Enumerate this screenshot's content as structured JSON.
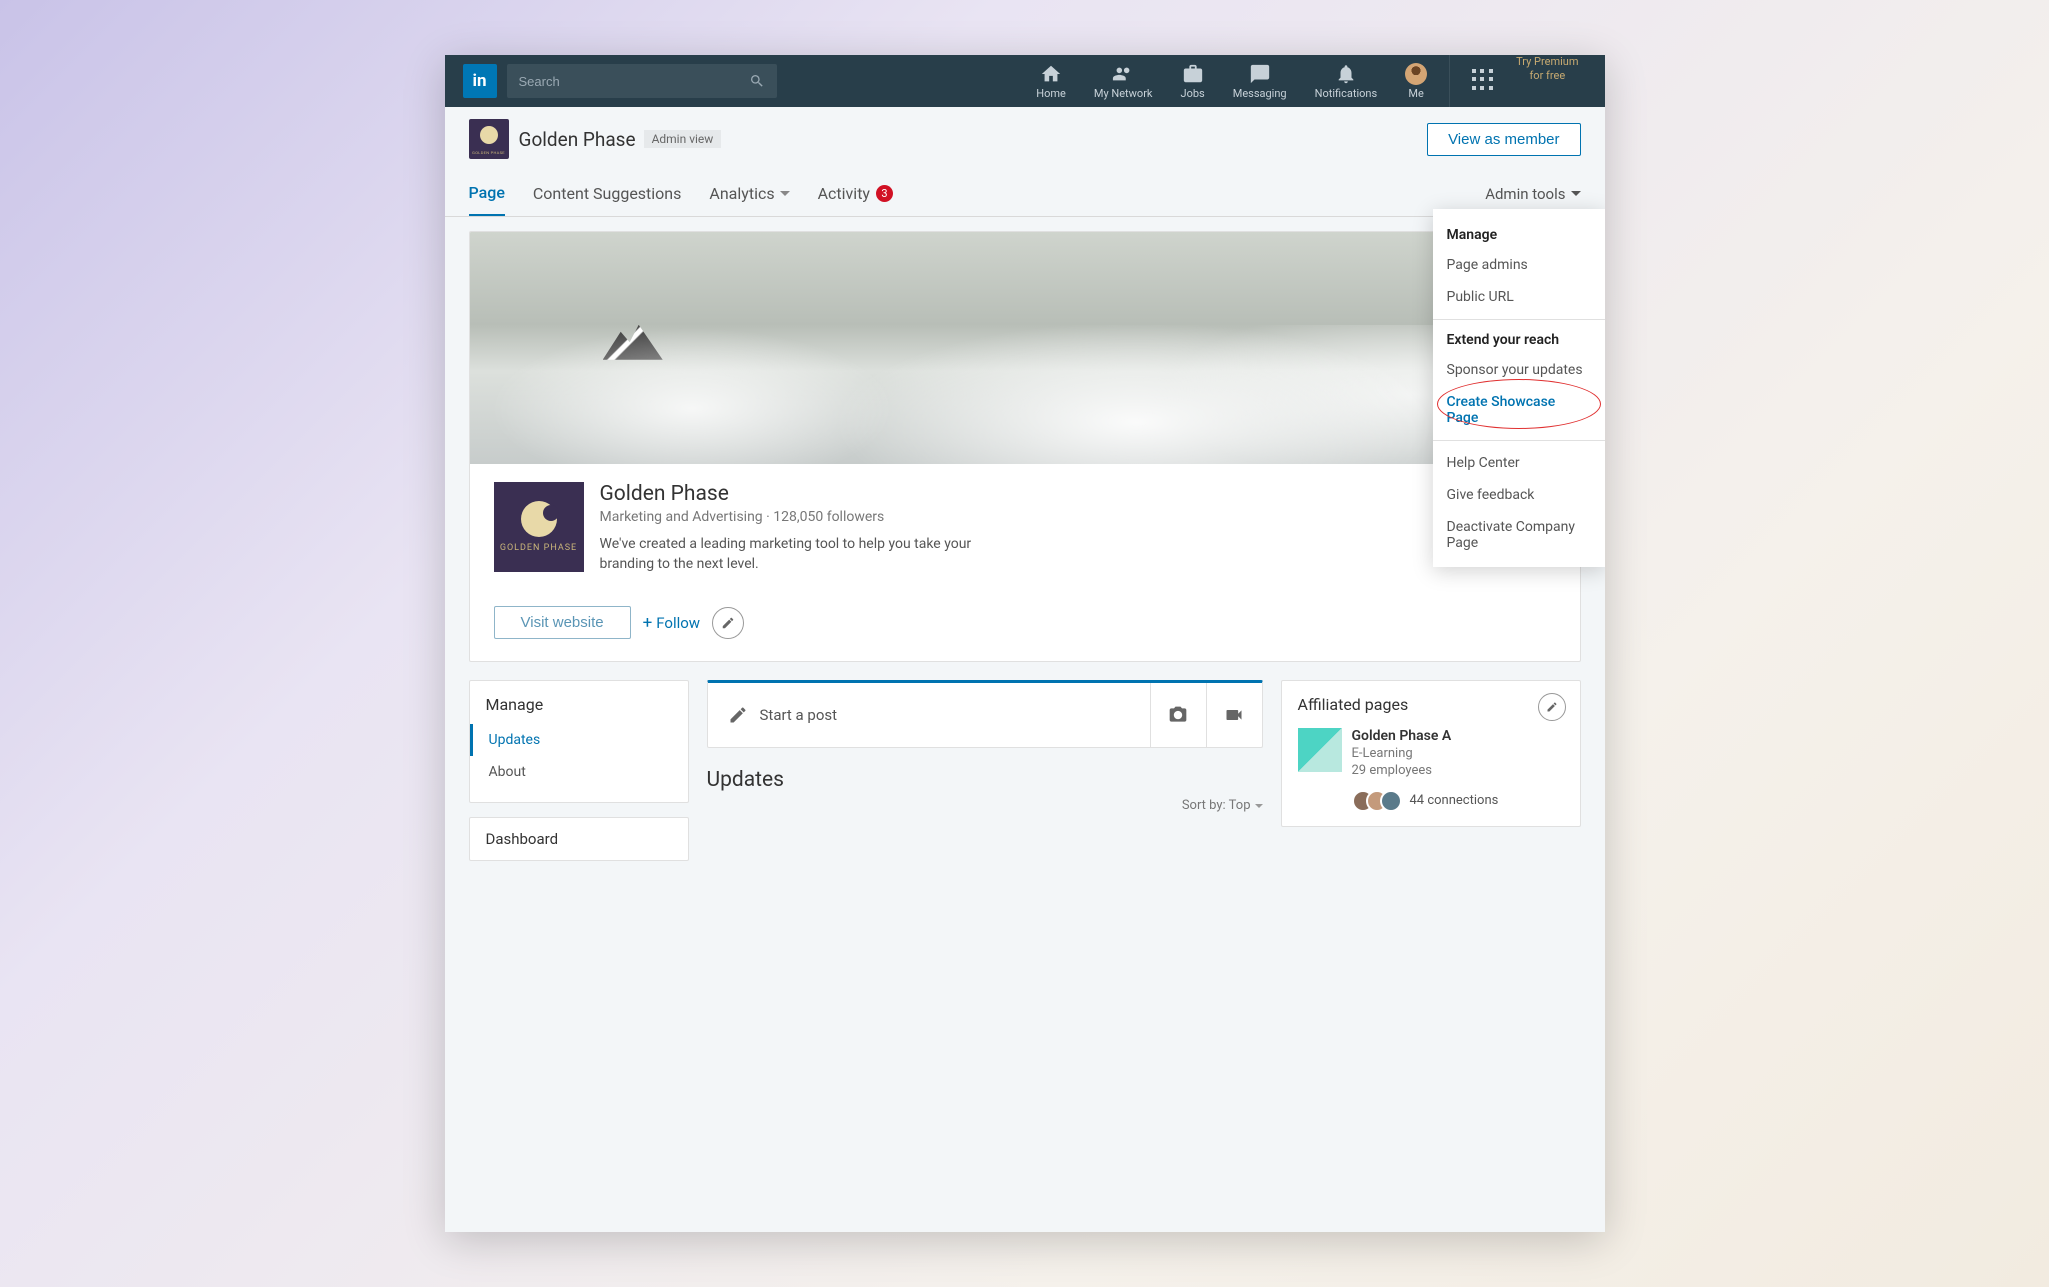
{
  "topbar": {
    "search_placeholder": "Search",
    "nav": {
      "home": "Home",
      "network": "My Network",
      "jobs": "Jobs",
      "messaging": "Messaging",
      "notifications": "Notifications",
      "me": "Me"
    },
    "premium_line1": "Try Premium",
    "premium_line2": "for free"
  },
  "pagebar": {
    "title": "Golden Phase",
    "admin_view": "Admin view",
    "view_member": "View as member"
  },
  "tabs": {
    "page": "Page",
    "content": "Content Suggestions",
    "analytics": "Analytics",
    "activity": "Activity",
    "activity_badge": "3",
    "admin_tools": "Admin tools"
  },
  "dropdown": {
    "manage_header": "Manage",
    "page_admins": "Page admins",
    "public_url": "Public URL",
    "extend_header": "Extend your reach",
    "sponsor": "Sponsor your updates",
    "showcase": "Create Showcase Page",
    "help": "Help Center",
    "feedback": "Give feedback",
    "deactivate": "Deactivate Company Page"
  },
  "hero": {
    "name": "Golden Phase",
    "meta": "Marketing and Advertising · 128,050 followers",
    "desc": "We've created a leading marketing tool to help you take your branding to the next level.",
    "logo_text": "GOLDEN PHASE",
    "visit": "Visit website",
    "follow": "Follow"
  },
  "manage": {
    "title": "Manage",
    "updates": "Updates",
    "about": "About",
    "dashboard": "Dashboard"
  },
  "post": {
    "start": "Start a post",
    "updates_title": "Updates",
    "sort": "Sort by: Top"
  },
  "affiliated": {
    "title": "Affiliated pages",
    "name": "Golden Phase A",
    "industry": "E-Learning",
    "employees": "29 employees",
    "connections": "44 connections"
  }
}
